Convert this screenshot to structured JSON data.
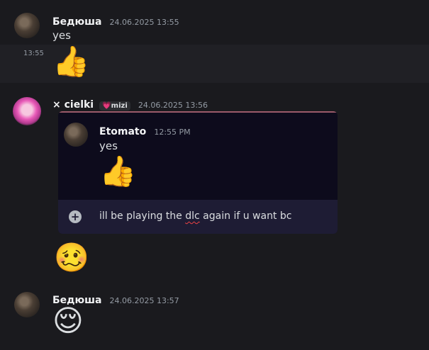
{
  "messages": [
    {
      "username": "Бедюша",
      "timestamp": "24.06.2025 13:55",
      "text": "yes",
      "followup": {
        "time": "13:55",
        "emoji": "👍"
      }
    },
    {
      "username": "× cielki",
      "tag": "💗mizi",
      "timestamp": "24.06.2025 13:56",
      "embed": {
        "username": "Etomato",
        "timestamp": "12:55 PM",
        "text": "yes",
        "emoji": "👍",
        "input": {
          "before": "ill be playing the ",
          "misspelled": "dlc",
          "after": " again if u want bc"
        }
      },
      "emoji": "🥴"
    },
    {
      "username": "Бедюша",
      "timestamp": "24.06.2025 13:57",
      "emoji": "😌"
    }
  ],
  "colors": {
    "background": "#1a1a1e",
    "hover": "#202025",
    "embed_bg": "#0d0b1c",
    "embed_input_bg": "#1e1c34"
  }
}
